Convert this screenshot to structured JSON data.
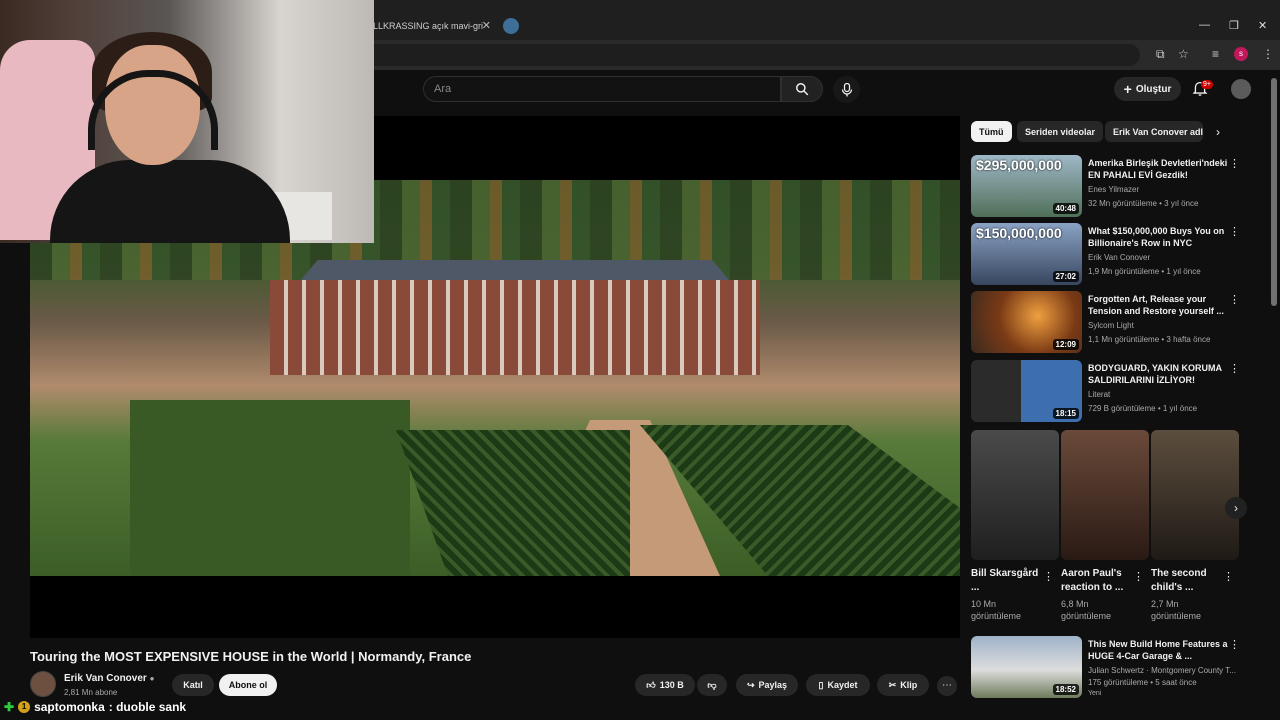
{
  "browser": {
    "tab_title": "LLKRASSING açık mavi-gri",
    "profile_initial": "s"
  },
  "header": {
    "search_placeholder": "Ara",
    "create_label": "Oluştur",
    "notifications_badge": "9+"
  },
  "video": {
    "title": "Touring the MOST EXPENSIVE HOUSE in the World | Normandy, France",
    "channel": "Erik Van Conover",
    "subscribers": "2,81 Mn abone",
    "join_label": "Katıl",
    "subscribe_label": "Abone ol",
    "likes": "130 B",
    "share_label": "Paylaş",
    "save_label": "Kaydet",
    "clip_label": "Klip"
  },
  "chips": [
    "Tümü",
    "Seriden videolar",
    "Erik Van Conover adlı"
  ],
  "recommendations": [
    {
      "title": "Amerika Birleşik Devletleri'ndeki EN PAHALI EVİ Gezdik!",
      "channel": "Enes Yilmazer",
      "meta": "32 Mn görüntüleme • 3 yıl önce",
      "duration": "40:48",
      "thumb_text": "$295,000,000",
      "thumb_color": "#6f8ea6"
    },
    {
      "title": "What $150,000,000 Buys You on Billionaire's Row in NYC",
      "channel": "Erik Van Conover",
      "meta": "1,9 Mn görüntüleme • 1 yıl önce",
      "duration": "27:02",
      "thumb_text": "$150,000,000",
      "thumb_color": "#7d93b1"
    },
    {
      "title": "Forgotten Art, Release your Tension and Restore yourself ...",
      "channel": "Sylcom Light",
      "meta": "1,1 Mn görüntüleme • 3 hafta önce",
      "duration": "12:09",
      "thumb_text": "",
      "thumb_color": "#8a5a35"
    },
    {
      "title": "BODYGUARD, YAKIN KORUMA SALDIRILARINI İZLİYOR!",
      "channel": "Literat",
      "meta": "729 B görüntüleme • 1 yıl önce",
      "duration": "18:15",
      "thumb_text": "",
      "thumb_color": "#3d6fae"
    }
  ],
  "shorts": [
    {
      "title": "Bill Skarsgård ...",
      "views": "10 Mn görüntüleme",
      "color": "#3a3a3a"
    },
    {
      "title": "Aaron Paul's reaction to ...",
      "views": "6,8 Mn görüntüleme",
      "color": "#5a3a30"
    },
    {
      "title": "The second child's ...",
      "views": "2,7 Mn görüntüleme",
      "color": "#4a4036"
    }
  ],
  "last_recommendation": {
    "title": "This New Build Home Features a HUGE 4-Car Garage & ...",
    "channel": "Julian Schwertz · Montgomery County T...",
    "meta": "175 görüntüleme • 5 saat önce",
    "badge": "Yeni",
    "duration": "18:52"
  },
  "chat": {
    "user": "saptomonka",
    "message": ": duoble sank",
    "badge": "1"
  }
}
